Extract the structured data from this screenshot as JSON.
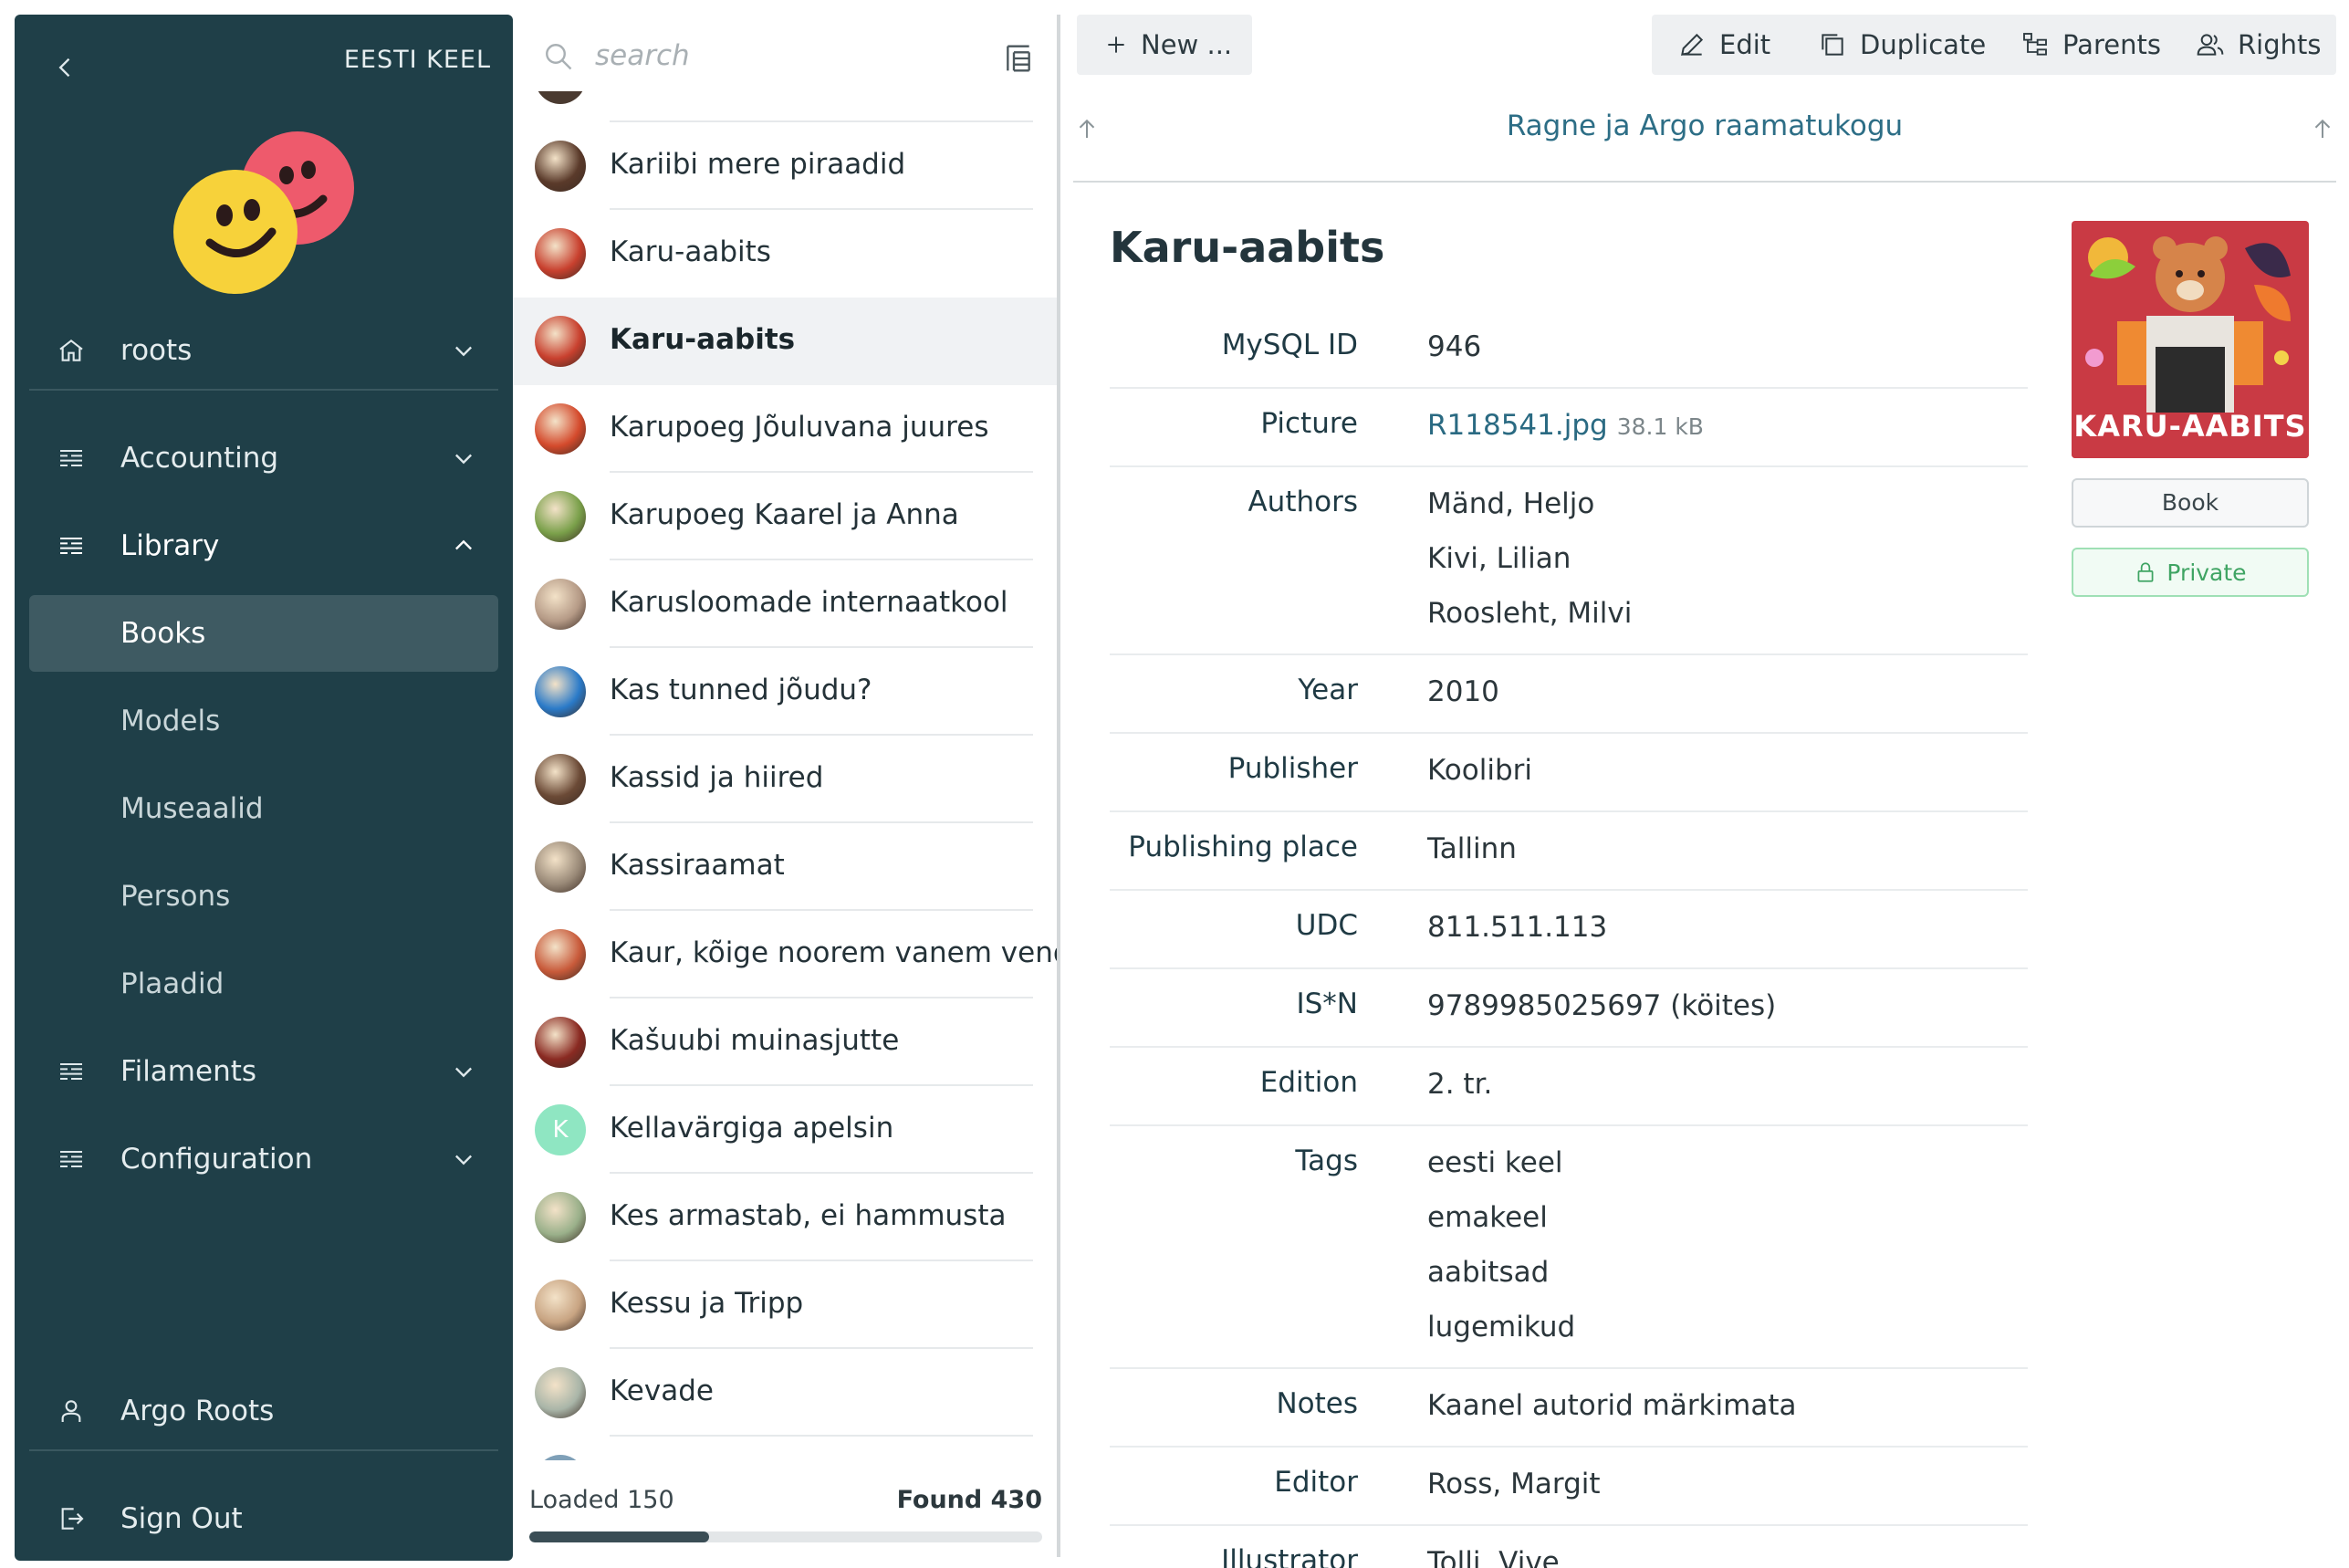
{
  "sidebar": {
    "language": "EESTI KEEL",
    "root_label": "roots",
    "items": [
      {
        "label": "Accounting"
      },
      {
        "label": "Library"
      },
      {
        "label": "Filaments"
      },
      {
        "label": "Configuration"
      }
    ],
    "library_children": [
      {
        "label": "Books"
      },
      {
        "label": "Models"
      },
      {
        "label": "Museaalid"
      },
      {
        "label": "Persons"
      },
      {
        "label": "Plaadid"
      }
    ],
    "user": "Argo Roots",
    "sign_out": "Sign Out"
  },
  "list": {
    "search_placeholder": "search",
    "items": [
      {
        "title": "Kariibi mere piraadid",
        "color": "#5a3a2a"
      },
      {
        "title": "Karu-aabits",
        "color": "#c8402e"
      },
      {
        "title": "Karu-aabits",
        "color": "#c8402e"
      },
      {
        "title": "Karupoeg Jõuluvana juures",
        "color": "#d44a2c"
      },
      {
        "title": "Karupoeg Kaarel ja Anna",
        "color": "#7aa04a"
      },
      {
        "title": "Karusloomade internaatkool",
        "color": "#b59a86"
      },
      {
        "title": "Kas tunned jõudu?",
        "color": "#2a7ac8"
      },
      {
        "title": "Kassid ja hiired",
        "color": "#6b4a36"
      },
      {
        "title": "Kassiraamat",
        "color": "#9a8a78"
      },
      {
        "title": "Kaur, kõige noorem vanem vend",
        "color": "#c85a3a"
      },
      {
        "title": "Kašuubi muinasjutte",
        "color": "#8a2a22"
      },
      {
        "title": "Kellavärgiga apelsin",
        "initial": "K",
        "color": "#8fe6c2"
      },
      {
        "title": "Kes armastab, ei hammusta",
        "color": "#9ab08a"
      },
      {
        "title": "Kessu ja Tripp",
        "color": "#c8a482"
      },
      {
        "title": "Kevade",
        "color": "#a9b5a8"
      }
    ],
    "loaded": "Loaded 150",
    "found": "Found 430",
    "progress": 0.35
  },
  "toolbar": {
    "new": "New ...",
    "edit": "Edit",
    "duplicate": "Duplicate",
    "parents": "Parents",
    "rights": "Rights"
  },
  "breadcrumb": "Ragne ja Argo raamatukogu",
  "entity": {
    "title": "Karu-aabits",
    "type": "Book",
    "visibility": "Private",
    "cover_text": "KARU-AABITS",
    "properties": [
      {
        "label": "MySQL ID",
        "values": [
          "946"
        ]
      },
      {
        "label": "Picture",
        "values": [
          "R118541.jpg"
        ],
        "size": "38.1 kB",
        "link": true
      },
      {
        "label": "Authors",
        "values": [
          "Mänd, Heljo",
          "Kivi, Lilian",
          "Roosleht, Milvi"
        ]
      },
      {
        "label": "Year",
        "values": [
          "2010"
        ]
      },
      {
        "label": "Publisher",
        "values": [
          "Koolibri"
        ]
      },
      {
        "label": "Publishing place",
        "values": [
          "Tallinn"
        ]
      },
      {
        "label": "UDC",
        "values": [
          "811.511.113"
        ]
      },
      {
        "label": "IS*N",
        "values": [
          "9789985025697 (köites)"
        ]
      },
      {
        "label": "Edition",
        "values": [
          "2. tr."
        ]
      },
      {
        "label": "Tags",
        "values": [
          "eesti keel",
          "emakeel",
          "aabitsad",
          "lugemikud"
        ]
      },
      {
        "label": "Notes",
        "values": [
          "Kaanel autorid märkimata"
        ]
      },
      {
        "label": "Editor",
        "values": [
          "Ross, Margit"
        ]
      },
      {
        "label": "Illustrator",
        "values": [
          "Tolli, Vive"
        ]
      }
    ]
  },
  "colors": {
    "sidebar_bg": "#1f3f48",
    "sidebar_active": "#3e5a62",
    "link": "#2a6a82",
    "private": "#3fa463"
  }
}
